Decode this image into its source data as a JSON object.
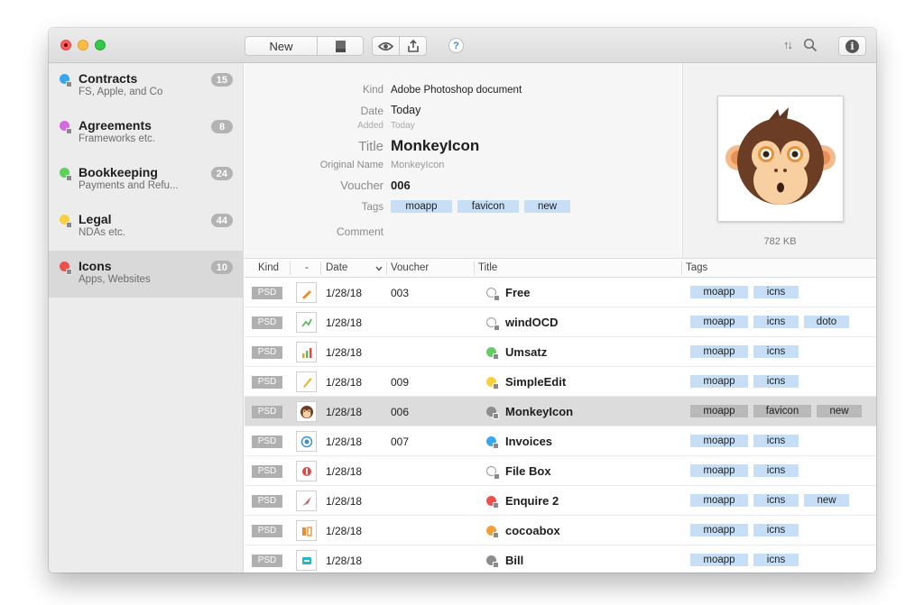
{
  "toolbar": {
    "new_label": "New",
    "help_label": "?",
    "sort_label": "↑↓",
    "info_label": "i"
  },
  "sidebar": {
    "items": [
      {
        "title": "Contracts",
        "subtitle": "FS, Apple, and Co",
        "count": "15",
        "color": "#39a6f2",
        "selected": false
      },
      {
        "title": "Agreements",
        "subtitle": "Frameworks etc.",
        "count": "8",
        "color": "#d26bdf",
        "selected": false
      },
      {
        "title": "Bookkeeping",
        "subtitle": "Payments and Refu...",
        "count": "24",
        "color": "#5fd05f",
        "selected": false
      },
      {
        "title": "Legal",
        "subtitle": "NDAs etc.",
        "count": "44",
        "color": "#fbd03c",
        "selected": false
      },
      {
        "title": "Icons",
        "subtitle": "Apps, Websites",
        "count": "10",
        "color": "#f0504b",
        "selected": true
      }
    ]
  },
  "detail": {
    "kind_label": "Kind",
    "kind_value": "Adobe Photoshop document",
    "date_label": "Date",
    "date_value": "Today",
    "added_label": "Added",
    "added_value": "Today",
    "title_label": "Title",
    "title_value": "MonkeyIcon",
    "origname_label": "Original Name",
    "origname_value": "MonkeyIcon",
    "voucher_label": "Voucher",
    "voucher_value": "006",
    "tags_label": "Tags",
    "tags": [
      "moapp",
      "favicon",
      "new"
    ],
    "comment_label": "Comment"
  },
  "preview": {
    "file_size": "782 KB"
  },
  "table": {
    "headers": {
      "kind": "Kind",
      "icon": "-",
      "date": "Date",
      "voucher": "Voucher",
      "title": "Title",
      "tags": "Tags"
    },
    "rows": [
      {
        "kind": "PSD",
        "icon": "pencil-icon",
        "icon_color": "#f08a24",
        "date": "1/28/18",
        "voucher": "003",
        "title": "Free",
        "dot": "",
        "tags": [
          "moapp",
          "icns"
        ],
        "selected": false
      },
      {
        "kind": "PSD",
        "icon": "graph-icon",
        "icon_color": "#5cb85c",
        "date": "1/28/18",
        "voucher": "",
        "title": "windOCD",
        "dot": "",
        "tags": [
          "moapp",
          "icns",
          "doto"
        ],
        "selected": false
      },
      {
        "kind": "PSD",
        "icon": "bar-chart-icon",
        "icon_color": "#e8a020",
        "date": "1/28/18",
        "voucher": "",
        "title": "Umsatz",
        "dot": "#5fd05f",
        "tags": [
          "moapp",
          "icns"
        ],
        "selected": false
      },
      {
        "kind": "PSD",
        "icon": "pen-icon",
        "icon_color": "#e8b020",
        "date": "1/28/18",
        "voucher": "009",
        "title": "SimpleEdit",
        "dot": "#fbd03c",
        "tags": [
          "moapp",
          "icns"
        ],
        "selected": false
      },
      {
        "kind": "PSD",
        "icon": "monkey-icon",
        "icon_color": "#6b3d24",
        "date": "1/28/18",
        "voucher": "006",
        "title": "MonkeyIcon",
        "dot": "#8c8c8c",
        "tags": [
          "moapp",
          "favicon",
          "new"
        ],
        "selected": true
      },
      {
        "kind": "PSD",
        "icon": "swirl-icon",
        "icon_color": "#3a8fd0",
        "date": "1/28/18",
        "voucher": "007",
        "title": "Invoices",
        "dot": "#39a6f2",
        "tags": [
          "moapp",
          "icns"
        ],
        "selected": false
      },
      {
        "kind": "PSD",
        "icon": "box-icon",
        "icon_color": "#e04848",
        "date": "1/28/18",
        "voucher": "",
        "title": "File Box",
        "dot": "",
        "tags": [
          "moapp",
          "icns"
        ],
        "selected": false
      },
      {
        "kind": "PSD",
        "icon": "compass-icon",
        "icon_color": "#e04848",
        "date": "1/28/18",
        "voucher": "",
        "title": "Enquire 2",
        "dot": "#f0504b",
        "tags": [
          "moapp",
          "icns",
          "new"
        ],
        "selected": false
      },
      {
        "kind": "PSD",
        "icon": "cocoa-box-icon",
        "icon_color": "#f08a24",
        "date": "1/28/18",
        "voucher": "",
        "title": "cocoabox",
        "dot": "#f5a030",
        "tags": [
          "moapp",
          "icns"
        ],
        "selected": false
      },
      {
        "kind": "PSD",
        "icon": "bill-icon",
        "icon_color": "#1fb8c8",
        "date": "1/28/18",
        "voucher": "",
        "title": "Bill",
        "dot": "#8c8c8c",
        "tags": [
          "moapp",
          "icns"
        ],
        "selected": false
      }
    ]
  }
}
